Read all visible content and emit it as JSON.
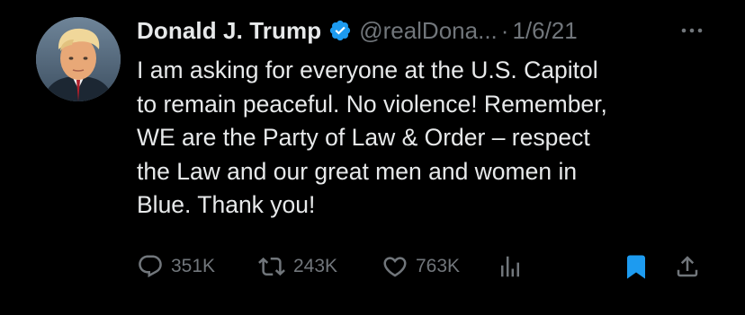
{
  "tweet": {
    "author_name": "Donald J. Trump",
    "handle": "@realDona...",
    "separator": "·",
    "date": "1/6/21",
    "text_lines": [
      "I am asking for everyone at the U.S. Capitol",
      "to remain peaceful. No violence! Remember,",
      "WE are the Party of Law & Order – respect",
      "the Law and our great men and women in",
      "Blue. Thank you!"
    ],
    "verified": true
  },
  "actions": {
    "reply_count": "351K",
    "retweet_count": "243K",
    "like_count": "763K"
  },
  "colors": {
    "background": "#000000",
    "text": "#e7e9ea",
    "muted": "#71767b",
    "accent": "#1d9bf0"
  },
  "icons": {
    "verified": "verified-badge-icon",
    "more": "more-options-icon",
    "reply": "reply-icon",
    "retweet": "retweet-icon",
    "like": "heart-icon",
    "views": "analytics-icon",
    "bookmark": "bookmark-icon",
    "share": "share-icon"
  }
}
